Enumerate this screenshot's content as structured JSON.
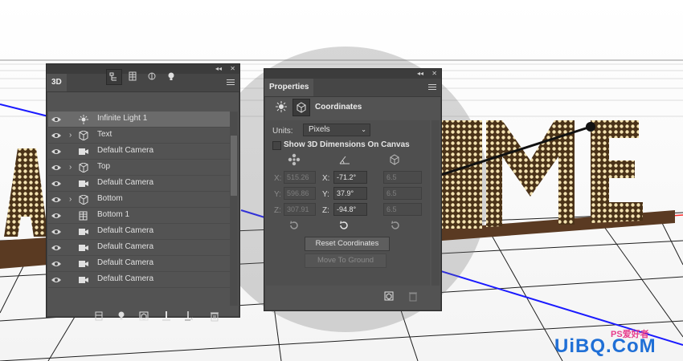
{
  "panel3d": {
    "tab": "3D",
    "collapse_glyph": "◂◂",
    "close_glyph": "✕",
    "toolbar_icons": [
      "scene-filter-icon",
      "mesh-filter-icon",
      "material-filter-icon",
      "light-filter-icon"
    ],
    "layers": [
      {
        "label": "Infinite Light 1",
        "icon": "light-icon",
        "expand": false,
        "selected": true
      },
      {
        "label": "Text",
        "icon": "mesh-icon",
        "expand": true,
        "selected": false
      },
      {
        "label": "Default Camera",
        "icon": "camera-icon",
        "expand": false,
        "selected": false
      },
      {
        "label": "Top",
        "icon": "mesh-icon",
        "expand": true,
        "selected": false
      },
      {
        "label": "Default Camera",
        "icon": "camera-icon",
        "expand": false,
        "selected": false
      },
      {
        "label": "Bottom",
        "icon": "mesh-icon",
        "expand": true,
        "selected": false
      },
      {
        "label": "Bottom 1",
        "icon": "layer-icon",
        "expand": false,
        "selected": false
      },
      {
        "label": "Default Camera",
        "icon": "camera-icon",
        "expand": false,
        "selected": false
      },
      {
        "label": "Default Camera",
        "icon": "camera-icon",
        "expand": false,
        "selected": false
      },
      {
        "label": "Default Camera",
        "icon": "camera-icon",
        "expand": false,
        "selected": false
      },
      {
        "label": "Default Camera",
        "icon": "camera-icon",
        "expand": false,
        "selected": false
      }
    ],
    "footer_icons": [
      "render-icon",
      "add-light-icon",
      "new-object-icon",
      "ground-icon",
      "delete-light-icon",
      "trash-icon"
    ]
  },
  "properties": {
    "tab": "Properties",
    "collapse_glyph": "◂◂",
    "close_glyph": "✕",
    "section": "Coordinates",
    "units_label": "Units:",
    "units_value": "Pixels",
    "show_dims": "Show 3D Dimensions On Canvas",
    "position": {
      "x_label": "X:",
      "y_label": "Y:",
      "z_label": "Z:",
      "x": "515.26",
      "y": "596.86",
      "z": "307.91"
    },
    "rotation": {
      "x_label": "X:",
      "y_label": "Y:",
      "z_label": "Z:",
      "x": "-71.2°",
      "y": "37.9°",
      "z": "-94.8°"
    },
    "scale": {
      "x": "6.5",
      "y": "6.5",
      "z": "6.5"
    },
    "reset_button": "Reset Coordinates",
    "ground_button": "Move To Ground"
  },
  "watermark": {
    "text": "UiBQ.CoM",
    "sub": "PS爱好者"
  },
  "colors": {
    "panel": "#535353",
    "header": "#3c3c3c",
    "accent_blue": "#1a1aff"
  }
}
